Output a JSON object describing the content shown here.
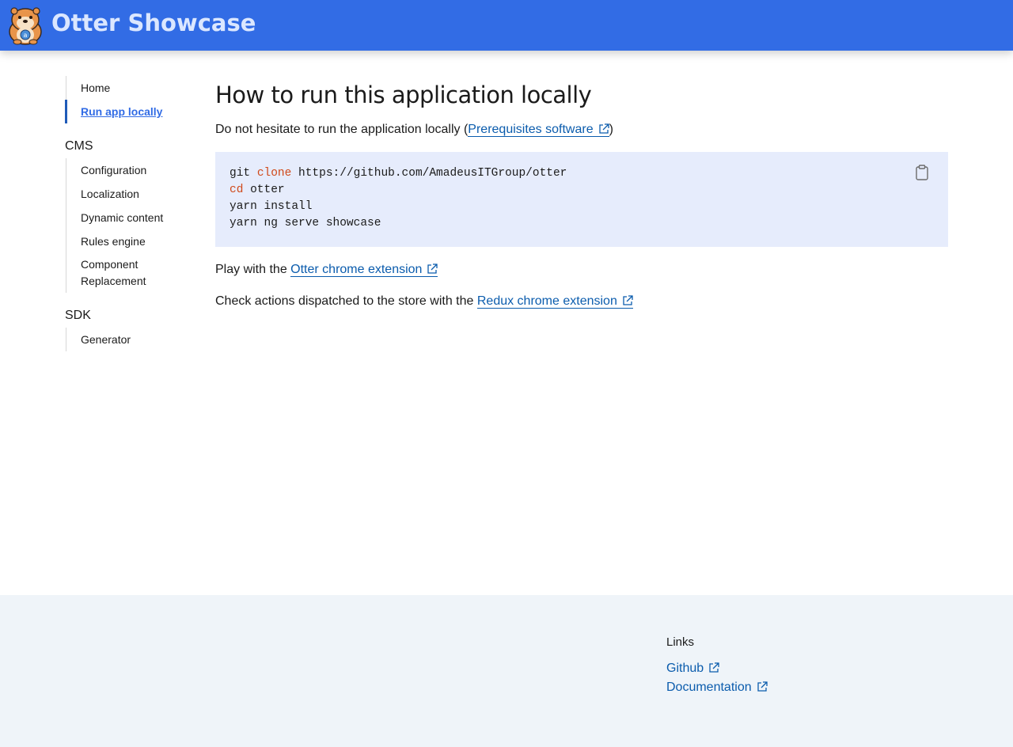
{
  "header": {
    "brand": "Otter Showcase",
    "logo_icon": "otter-mascot-icon",
    "background_color": "#326ce5"
  },
  "sidebar": {
    "items": [
      {
        "label": "Home",
        "active": false
      },
      {
        "label": "Run app locally",
        "active": true
      }
    ],
    "groups": [
      {
        "heading": "CMS",
        "items": [
          {
            "label": "Configuration"
          },
          {
            "label": "Localization"
          },
          {
            "label": "Dynamic content"
          },
          {
            "label": "Rules engine"
          },
          {
            "label": "Component Replacement"
          }
        ]
      },
      {
        "heading": "SDK",
        "items": [
          {
            "label": "Generator"
          }
        ]
      }
    ]
  },
  "main": {
    "title": "How to run this application locally",
    "intro": {
      "text_before": "Do not hesitate to run the application locally (",
      "link": "Prerequisites software",
      "text_after": ")"
    },
    "code": {
      "lines": [
        {
          "cmd": "git ",
          "kw": "clone",
          "rest": " https://github.com/AmadeusITGroup/otter"
        },
        {
          "cmd": "",
          "kw": "cd",
          "rest": " otter"
        },
        {
          "cmd": "yarn install",
          "kw": "",
          "rest": ""
        },
        {
          "cmd": "yarn ng serve showcase",
          "kw": "",
          "rest": ""
        }
      ],
      "copy_icon": "clipboard-icon"
    },
    "play": {
      "text_before": "Play with the ",
      "link": "Otter chrome extension"
    },
    "check": {
      "text_before": "Check actions dispatched to the store with the ",
      "link": "Redux chrome extension"
    }
  },
  "footer": {
    "heading": "Links",
    "links": [
      "Github",
      "Documentation"
    ]
  },
  "colors": {
    "link": "#0b5cad",
    "keyword": "#d0491a",
    "code_background": "#e6ecfc",
    "footer_background": "#eff4f9"
  }
}
